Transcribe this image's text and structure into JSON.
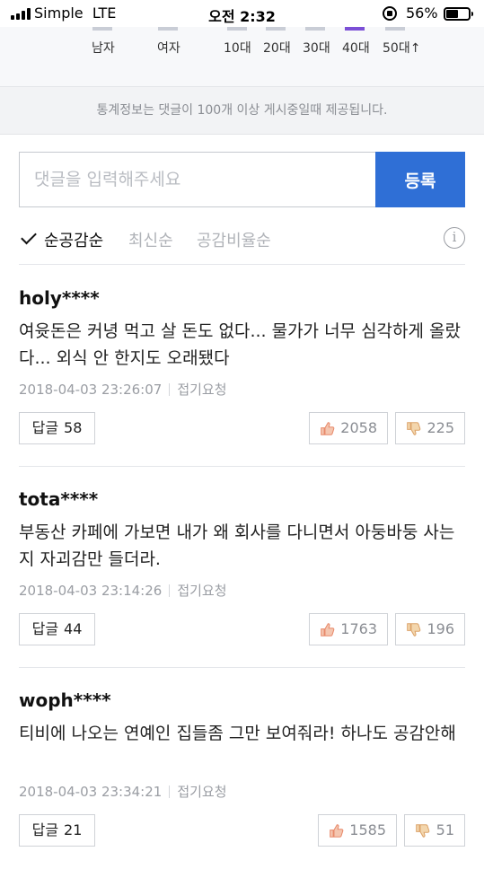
{
  "status_bar": {
    "carrier": "Simple",
    "network": "LTE",
    "time": "오전 2:32",
    "battery_percent": "56%",
    "battery_level": 0.56
  },
  "stats": {
    "labels": [
      "남자",
      "여자",
      "10대",
      "20대",
      "30대",
      "40대",
      "50대↑"
    ],
    "highlight_color": "#7b4fd6"
  },
  "notice": "통계정보는 댓글이 100개 이상 게시중일때 제공됩니다.",
  "comment_input": {
    "placeholder": "댓글을 입력해주세요",
    "value": ""
  },
  "submit_label": "등록",
  "sort_tabs": [
    {
      "label": "순공감순",
      "active": true
    },
    {
      "label": "최신순",
      "active": false
    },
    {
      "label": "공감비율순",
      "active": false
    }
  ],
  "comments": [
    {
      "author": "holy****",
      "text": "여윳돈은 커녕 먹고 살 돈도 없다... 물가가 너무 심각하게 올랐다... 외식 안 한지도 오래됐다",
      "date": "2018-04-03 23:26:07",
      "fold": "접기요청",
      "reply_label": "답글",
      "reply_count": "58",
      "likes": "2058",
      "dislikes": "225"
    },
    {
      "author": "tota****",
      "text": "부동산 카페에 가보면 내가 왜 회사를 다니면서 아둥바둥 사는지 자괴감만 들더라.",
      "date": "2018-04-03 23:14:26",
      "fold": "접기요청",
      "reply_label": "답글",
      "reply_count": "44",
      "likes": "1763",
      "dislikes": "196"
    },
    {
      "author": "woph****",
      "text": "티비에 나오는 연예인 집들좀 그만 보여줘라! 하나도 공감안해",
      "date": "2018-04-03 23:34:21",
      "fold": "접기요청",
      "reply_label": "답글",
      "reply_count": "21",
      "likes": "1585",
      "dislikes": "51"
    }
  ],
  "icons": {
    "like": "thumbs-up-icon",
    "dislike": "thumbs-down-icon",
    "info": "info-icon",
    "check": "check-icon"
  },
  "colors": {
    "accent": "#2f6fd6",
    "like_icon": "#f0a07a",
    "dislike_icon": "#e7b67a"
  }
}
